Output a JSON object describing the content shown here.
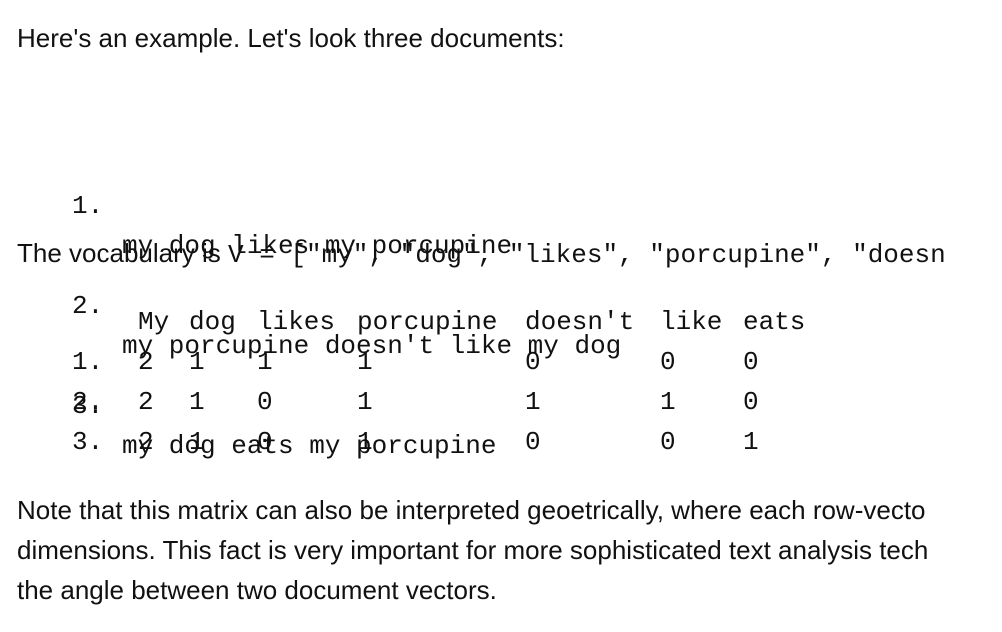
{
  "intro_text": "Here's an example. Let's look three documents:",
  "documents": [
    {
      "number": "1.",
      "text": "my dog likes my porcupine"
    },
    {
      "number": "2.",
      "text": "my porcupine doesn't like my dog"
    },
    {
      "number": "3.",
      "text": "my dog eats my porcupine"
    }
  ],
  "vocabulary": {
    "prefix": "The vocabulary is ",
    "code": "V = [\"my\", \"dog\", \"likes\", \"porcupine\", \"doesn"
  },
  "matrix": {
    "headers": [
      "My",
      "dog",
      "likes",
      "porcupine",
      "doesn't",
      "like",
      "eats"
    ],
    "rows": [
      {
        "label": "1.",
        "values": [
          "2",
          "1",
          "1",
          "1",
          "0",
          "0",
          "0"
        ]
      },
      {
        "label": "2.",
        "values": [
          "2",
          "1",
          "0",
          "1",
          "1",
          "1",
          "0"
        ]
      },
      {
        "label": "3.",
        "values": [
          "2",
          "1",
          "0",
          "1",
          "0",
          "0",
          "1"
        ]
      }
    ]
  },
  "note_lines": [
    "Note that this matrix can also be interpreted geoetrically, where each row-vecto",
    "dimensions. This fact is very important for more sophisticated text analysis tech",
    "the angle between two document vectors."
  ]
}
